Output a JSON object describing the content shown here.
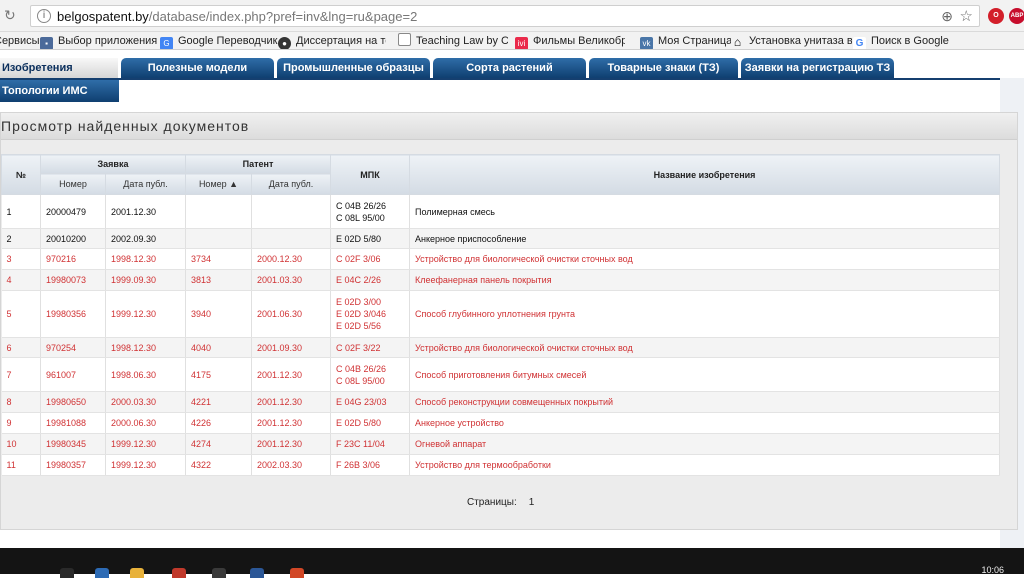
{
  "browser": {
    "url_host": "belgospatent.by",
    "url_path": "/database/index.php?pref=inv&lng=ru&page=2",
    "bookmarks": [
      {
        "label": "Сервисы",
        "icon": "apps-icon"
      },
      {
        "label": "Выбор приложения",
        "icon": "app-icon"
      },
      {
        "label": "Google Переводчик",
        "icon": "translate-icon"
      },
      {
        "label": "Диссертация на тему",
        "icon": "site-icon"
      },
      {
        "label": "Teaching Law by Case",
        "icon": "page-icon"
      },
      {
        "label": "Фильмы Великобрит",
        "icon": "ivi-icon"
      },
      {
        "label": "Моя Страница",
        "icon": "vk-icon"
      },
      {
        "label": "Установка унитаза в",
        "icon": "house-icon"
      },
      {
        "label": "Поиск в Google",
        "icon": "google-icon"
      }
    ]
  },
  "tabs": [
    {
      "label": "Изобретения",
      "active": true
    },
    {
      "label": "Полезные модели",
      "active": false
    },
    {
      "label": "Промышленные образцы",
      "active": false
    },
    {
      "label": "Сорта растений",
      "active": false
    },
    {
      "label": "Товарные знаки (ТЗ)",
      "active": false
    },
    {
      "label": "Заявки на регистрацию ТЗ",
      "active": false
    }
  ],
  "subtab": "Топологии ИМС",
  "panel": {
    "title": "Просмотр найденных документов"
  },
  "table": {
    "headers": {
      "num": "№",
      "application": "Заявка",
      "patent": "Патент",
      "mpk": "МПК",
      "title": "Название изобретения",
      "app_number": "Номер",
      "app_date": "Дата публ.",
      "pat_number": "Номер ▲",
      "pat_date": "Дата публ."
    },
    "rows": [
      {
        "n": "1",
        "app_no": "20000479",
        "app_date": "2001.12.30",
        "pat_no": "",
        "pat_date": "",
        "mpk": [
          "C 04B 26/26",
          "C 08L 95/00"
        ],
        "title": "Полимерная смесь",
        "color": "black"
      },
      {
        "n": "2",
        "app_no": "20010200",
        "app_date": "2002.09.30",
        "pat_no": "",
        "pat_date": "",
        "mpk": [
          "E 02D 5/80"
        ],
        "title": "Анкерное приспособление",
        "color": "black"
      },
      {
        "n": "3",
        "app_no": "970216",
        "app_date": "1998.12.30",
        "pat_no": "3734",
        "pat_date": "2000.12.30",
        "mpk": [
          "C 02F 3/06"
        ],
        "title": "Устройство для биологической очистки сточных вод",
        "color": "red"
      },
      {
        "n": "4",
        "app_no": "19980073",
        "app_date": "1999.09.30",
        "pat_no": "3813",
        "pat_date": "2001.03.30",
        "mpk": [
          "E 04C 2/26"
        ],
        "title": "Клеефанерная панель покрытия",
        "color": "red"
      },
      {
        "n": "5",
        "app_no": "19980356",
        "app_date": "1999.12.30",
        "pat_no": "3940",
        "pat_date": "2001.06.30",
        "mpk": [
          "E 02D 3/00",
          "E 02D 3/046",
          "E 02D 5/56"
        ],
        "title": "Способ глубинного уплотнения грунта",
        "color": "red"
      },
      {
        "n": "6",
        "app_no": "970254",
        "app_date": "1998.12.30",
        "pat_no": "4040",
        "pat_date": "2001.09.30",
        "mpk": [
          "C 02F 3/22"
        ],
        "title": "Устройство для биологической очистки сточных вод",
        "color": "red"
      },
      {
        "n": "7",
        "app_no": "961007",
        "app_date": "1998.06.30",
        "pat_no": "4175",
        "pat_date": "2001.12.30",
        "mpk": [
          "C 04B 26/26",
          "C 08L 95/00"
        ],
        "title": "Способ приготовления битумных смесей",
        "color": "red"
      },
      {
        "n": "8",
        "app_no": "19980650",
        "app_date": "2000.03.30",
        "pat_no": "4221",
        "pat_date": "2001.12.30",
        "mpk": [
          "E 04G 23/03"
        ],
        "title": "Способ реконструкции совмещенных покрытий",
        "color": "red"
      },
      {
        "n": "9",
        "app_no": "19981088",
        "app_date": "2000.06.30",
        "pat_no": "4226",
        "pat_date": "2001.12.30",
        "mpk": [
          "E 02D 5/80"
        ],
        "title": "Анкерное устройство",
        "color": "red"
      },
      {
        "n": "10",
        "app_no": "19980345",
        "app_date": "1999.12.30",
        "pat_no": "4274",
        "pat_date": "2001.12.30",
        "mpk": [
          "F 23C 11/04"
        ],
        "title": "Огневой аппарат",
        "color": "red"
      },
      {
        "n": "11",
        "app_no": "19980357",
        "app_date": "1999.12.30",
        "pat_no": "4322",
        "pat_date": "2002.03.30",
        "mpk": [
          "F 26B 3/06"
        ],
        "title": "Устройство для термообработки",
        "color": "red"
      }
    ]
  },
  "pagination": {
    "label": "Страницы:",
    "current": "1"
  },
  "taskbar": {
    "clock": "10:06"
  }
}
